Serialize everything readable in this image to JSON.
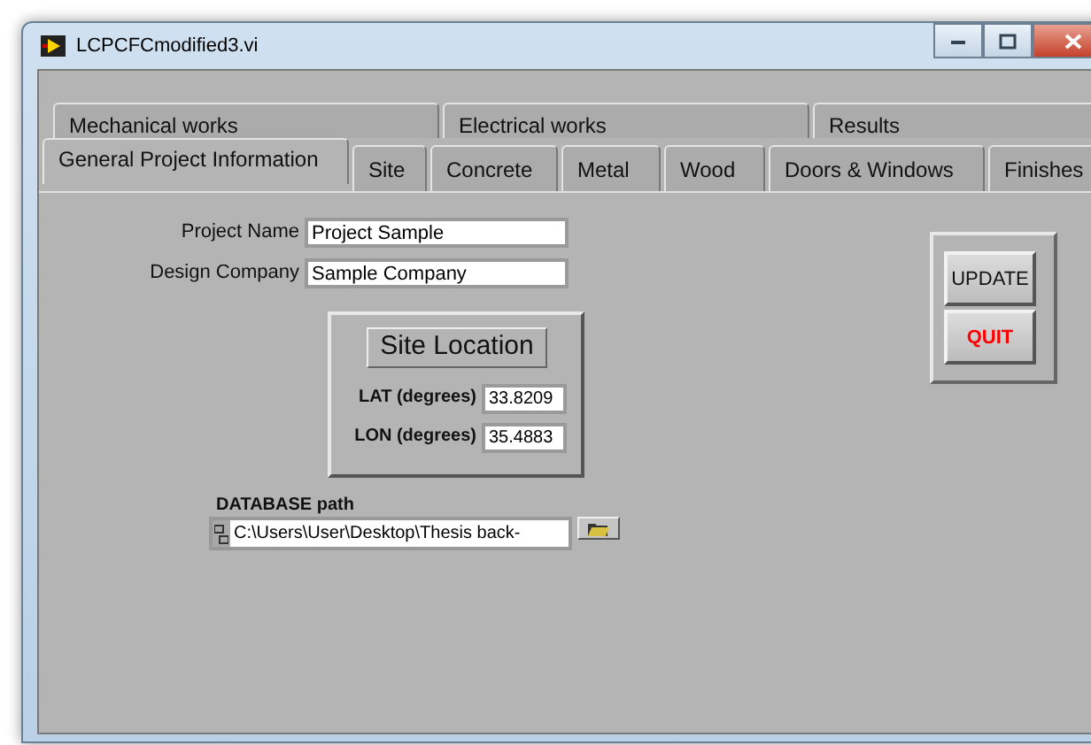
{
  "window": {
    "title": "LCPCFCmodified3.vi"
  },
  "tab_rows": [
    [
      {
        "label": "Mechanical works",
        "selected": false
      },
      {
        "label": "Electrical works",
        "selected": false
      },
      {
        "label": "Results",
        "selected": false
      }
    ],
    [
      {
        "label": "General Project Information",
        "selected": true
      },
      {
        "label": "Site",
        "selected": false
      },
      {
        "label": "Concrete",
        "selected": false
      },
      {
        "label": "Metal",
        "selected": false
      },
      {
        "label": "Wood",
        "selected": false
      },
      {
        "label": "Doors & Windows",
        "selected": false
      },
      {
        "label": "Finishes",
        "selected": false
      }
    ]
  ],
  "fields": [
    {
      "label": "Project Name",
      "value": "Project Sample"
    },
    {
      "label": "Design Company",
      "value": "Sample Company"
    }
  ],
  "site_location": {
    "title": "Site Location",
    "fields": [
      {
        "label": "LAT (degrees)",
        "value": "33.8209"
      },
      {
        "label": "LON (degrees)",
        "value": "35.4883"
      }
    ]
  },
  "database_path": {
    "label": "DATABASE path",
    "value": "C:\\Users\\User\\Desktop\\Thesis back-"
  },
  "buttons": [
    {
      "label": "UPDATE",
      "kind": "normal"
    },
    {
      "label": "QUIT",
      "kind": "danger"
    }
  ]
}
